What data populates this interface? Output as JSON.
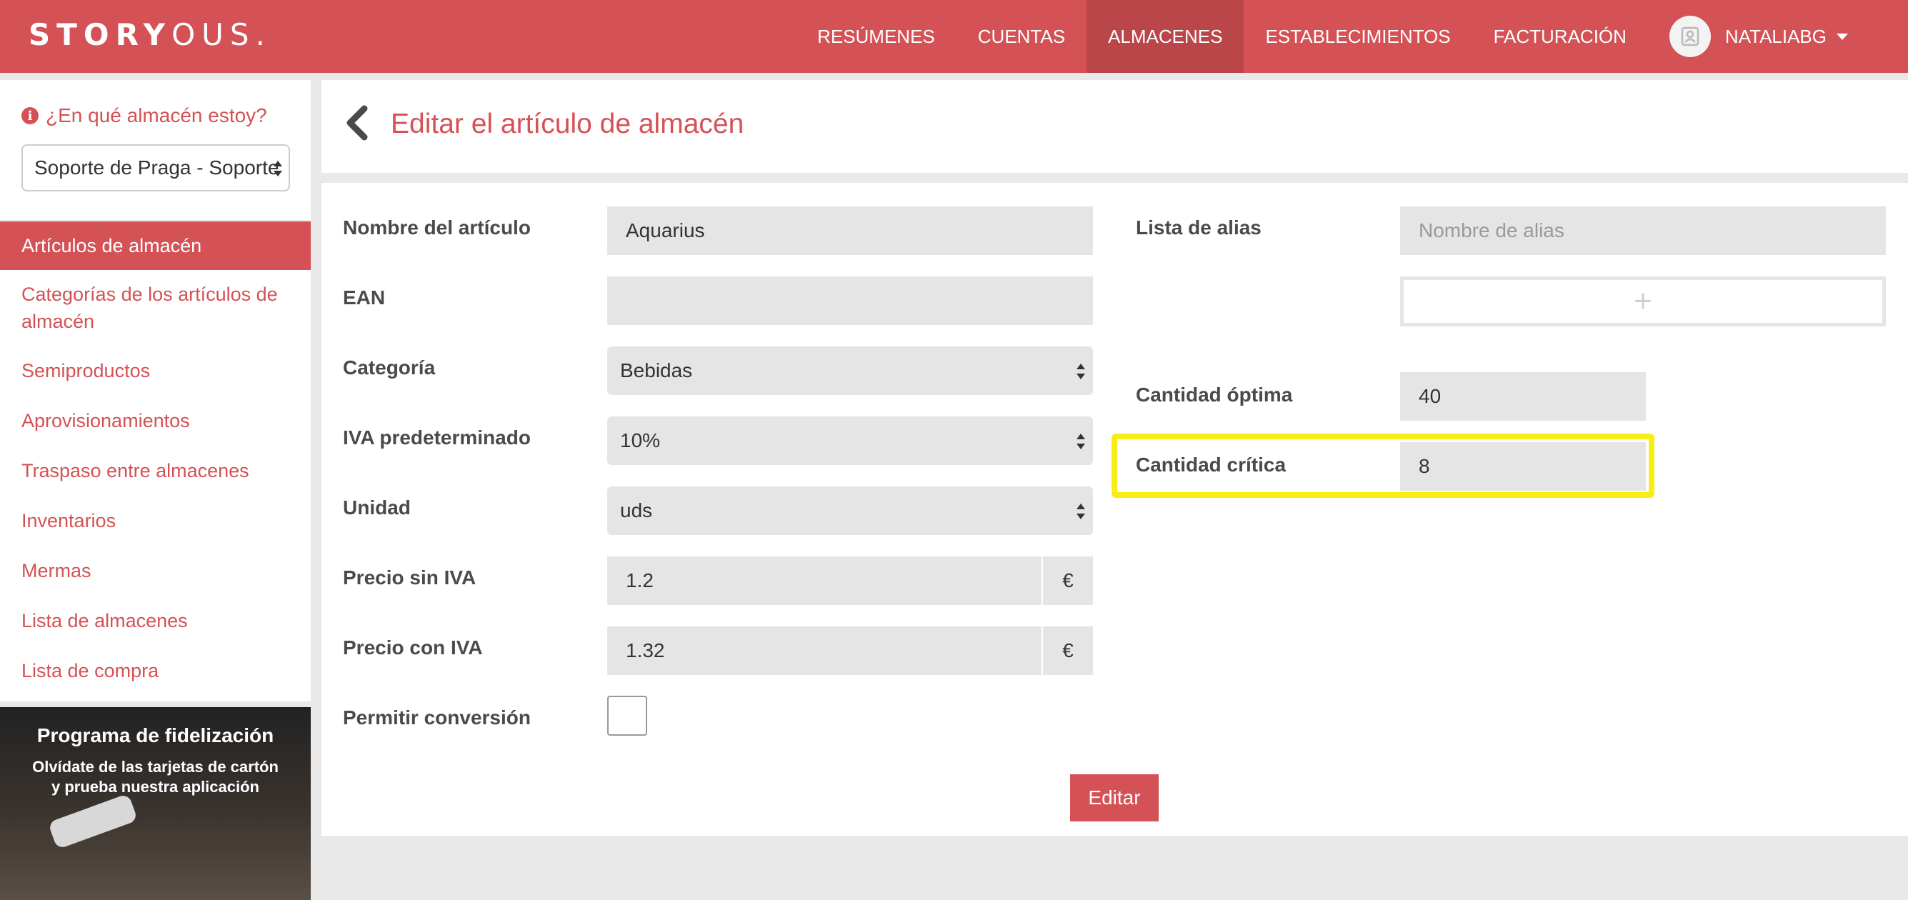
{
  "navbar": {
    "logo_bold": "STORY",
    "logo_light": "OUS.",
    "items": [
      {
        "label": "RESÚMENES"
      },
      {
        "label": "CUENTAS"
      },
      {
        "label": "ALMACENES",
        "active": true
      },
      {
        "label": "ESTABLECIMIENTOS"
      },
      {
        "label": "FACTURACIÓN"
      }
    ],
    "user": "NATALIABG",
    "accent_color": "#d45256"
  },
  "sidebar": {
    "question": "¿En qué almacén estoy?",
    "warehouse_select": "Soporte de Praga - Soporte",
    "menu": [
      {
        "label": "Artículos de almacén",
        "active": true
      },
      {
        "label": "Categorías de los artículos de almacén"
      },
      {
        "label": "Semiproductos"
      },
      {
        "label": "Aprovisionamientos"
      },
      {
        "label": "Traspaso entre almacenes"
      },
      {
        "label": "Inventarios"
      },
      {
        "label": "Mermas"
      },
      {
        "label": "Lista de almacenes"
      },
      {
        "label": "Lista de compra"
      }
    ],
    "promo": {
      "title": "Programa de fidelización",
      "subtitle_line1": "Olvídate de las tarjetas de cartón",
      "subtitle_line2": "y prueba nuestra aplicación"
    }
  },
  "page": {
    "title": "Editar el artículo de almacén"
  },
  "form": {
    "nombre": {
      "label": "Nombre del artículo",
      "value": "Aquarius"
    },
    "ean": {
      "label": "EAN",
      "value": ""
    },
    "categoria": {
      "label": "Categoría",
      "value": "Bebidas"
    },
    "iva": {
      "label": "IVA predeterminado",
      "value": "10%"
    },
    "unidad": {
      "label": "Unidad",
      "value": "uds"
    },
    "precio_sin": {
      "label": "Precio sin IVA",
      "value": "1.2",
      "currency": "€"
    },
    "precio_con": {
      "label": "Precio con IVA",
      "value": "1.32",
      "currency": "€"
    },
    "conversion": {
      "label": "Permitir conversión",
      "checked": false
    },
    "alias": {
      "label": "Lista de alias",
      "placeholder": "Nombre de alias",
      "add_symbol": "+"
    },
    "optima": {
      "label": "Cantidad óptima",
      "value": "40"
    },
    "critica": {
      "label": "Cantidad crítica",
      "value": "8",
      "highlight_color": "#f8ee16"
    },
    "submit_label": "Editar"
  }
}
